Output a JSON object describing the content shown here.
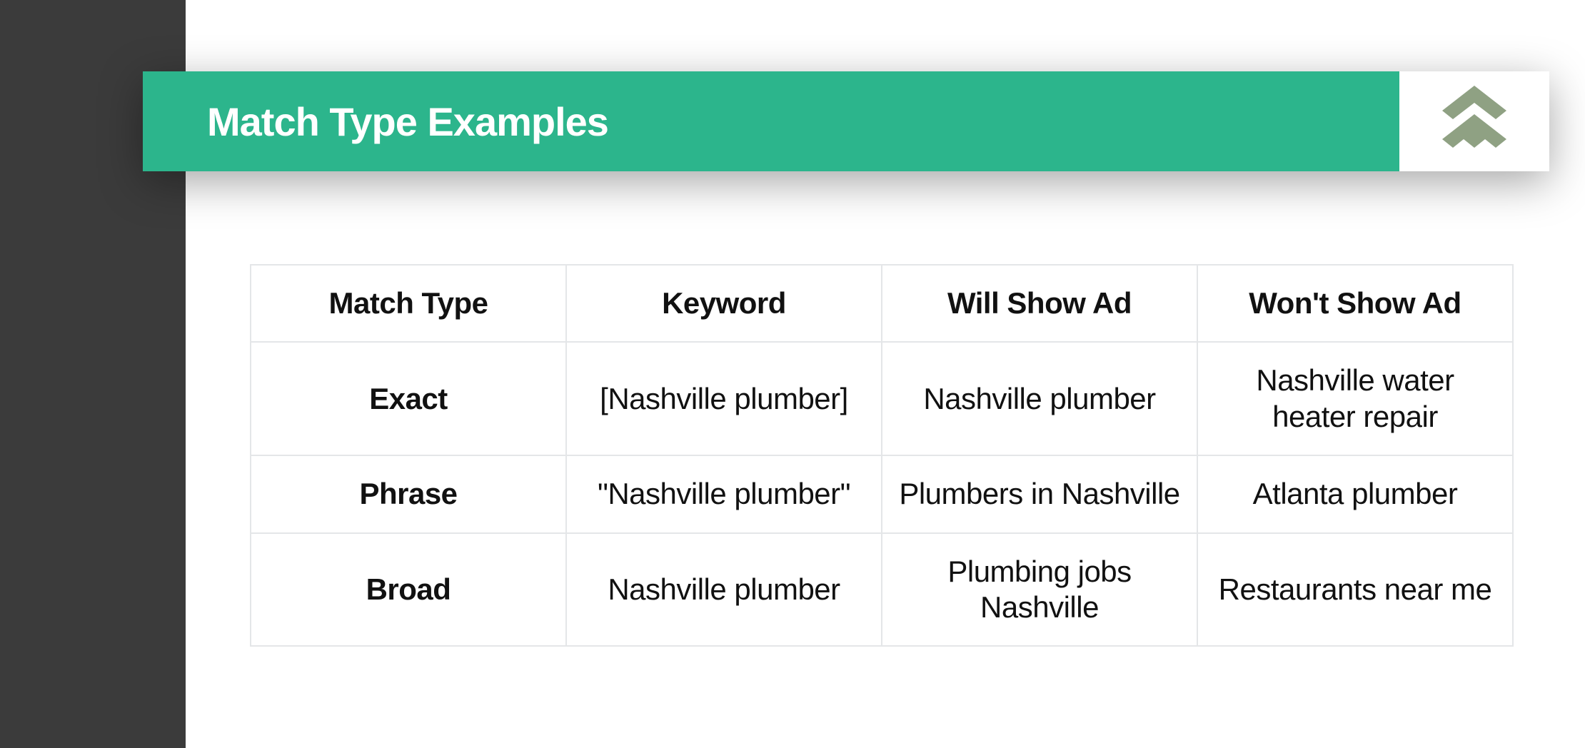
{
  "header": {
    "title": "Match Type Examples"
  },
  "table": {
    "headers": [
      "Match Type",
      "Keyword",
      "Will Show Ad",
      "Won't Show Ad"
    ],
    "rows": [
      {
        "match_type": "Exact",
        "keyword": "[Nashville plumber]",
        "will_show": "Nashville plumber",
        "wont_show": "Nashville water heater repair"
      },
      {
        "match_type": "Phrase",
        "keyword": "\"Nashville plumber\"",
        "will_show": "Plumbers in Nashville",
        "wont_show": "Atlanta plumber"
      },
      {
        "match_type": "Broad",
        "keyword": "Nashville plumber",
        "will_show": "Plumbing jobs Nashville",
        "wont_show": "Restaurants near me"
      }
    ]
  }
}
